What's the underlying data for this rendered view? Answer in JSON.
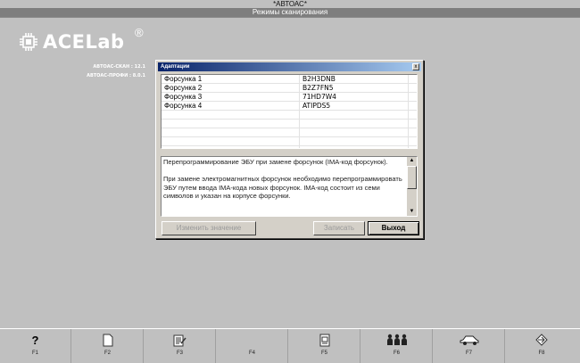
{
  "app": {
    "title": "*АВТОАС*",
    "mode": "Режимы сканирования"
  },
  "logo": {
    "text": "ACELab",
    "reg": "®"
  },
  "versions": [
    "АВТОАС-СКАН : 12.1",
    "АВТОАС-ПРОФИ : 8.0.1"
  ],
  "dialog": {
    "title": "Адаптации",
    "close": "x",
    "rows": [
      {
        "name": "Форсунка 1",
        "value": "B2H3DNB"
      },
      {
        "name": "Форсунка 2",
        "value": "B2Z7FN5"
      },
      {
        "name": "Форсунка 3",
        "value": "71HD7W4"
      },
      {
        "name": "Форсунка 4",
        "value": "ATIPDS5"
      }
    ],
    "description": [
      "Перепрограммирование ЭБУ при замене форсунок (IMA-код форсунок).",
      "При замене электромагнитных форсунок необходимо перепрограммировать ЭБУ путем ввода IMA-кода новых форсунок. IMA-код состоит из семи символов и указан на корпусе форсунки."
    ],
    "buttons": {
      "change": "Изменить значение",
      "write": "Записать",
      "exit": "Выход"
    }
  },
  "fkeys": [
    {
      "label": "F1",
      "icon": "help-icon",
      "glyph": "?"
    },
    {
      "label": "F2",
      "icon": "document-icon",
      "glyph": ""
    },
    {
      "label": "F3",
      "icon": "notes-icon",
      "glyph": ""
    },
    {
      "label": "F4",
      "icon": "",
      "glyph": ""
    },
    {
      "label": "F5",
      "icon": "report-icon",
      "glyph": ""
    },
    {
      "label": "F6",
      "icon": "users-icon",
      "glyph": ""
    },
    {
      "label": "F7",
      "icon": "car-icon",
      "glyph": ""
    },
    {
      "label": "F8",
      "icon": "exit-icon",
      "glyph": ""
    }
  ],
  "colors": {
    "background": "#c0c0c0",
    "mode_bar": "#7e7e7e",
    "dialog_title_start": "#0a246a",
    "dialog_title_end": "#a6caf0"
  }
}
